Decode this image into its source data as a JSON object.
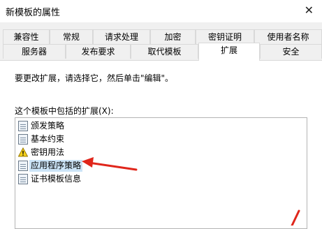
{
  "window": {
    "title": "新模板的属性",
    "close_glyph": "✕"
  },
  "tabs_row1": [
    {
      "label": "兼容性"
    },
    {
      "label": "常规"
    },
    {
      "label": "请求处理"
    },
    {
      "label": "加密"
    },
    {
      "label": "密钥证明"
    },
    {
      "label": "使用者名称"
    }
  ],
  "tabs_row2": [
    {
      "label": "服务器"
    },
    {
      "label": "发布要求"
    },
    {
      "label": "取代模板"
    },
    {
      "label": "扩展",
      "active": true
    },
    {
      "label": "安全"
    }
  ],
  "panel": {
    "instruction": "要更改扩展，请选择它，然后单击\"编辑\"。",
    "list_label": "这个模板中包括的扩展(X):",
    "extensions": [
      {
        "label": "颁发策略",
        "icon": "document-icon"
      },
      {
        "label": "基本约束",
        "icon": "document-icon"
      },
      {
        "label": "密钥用法",
        "icon": "warning-icon"
      },
      {
        "label": "应用程序策略",
        "icon": "document-icon",
        "selected": true
      },
      {
        "label": "证书模板信息",
        "icon": "document-icon"
      }
    ]
  },
  "annotation_colors": {
    "arrow": "#e0261b"
  }
}
